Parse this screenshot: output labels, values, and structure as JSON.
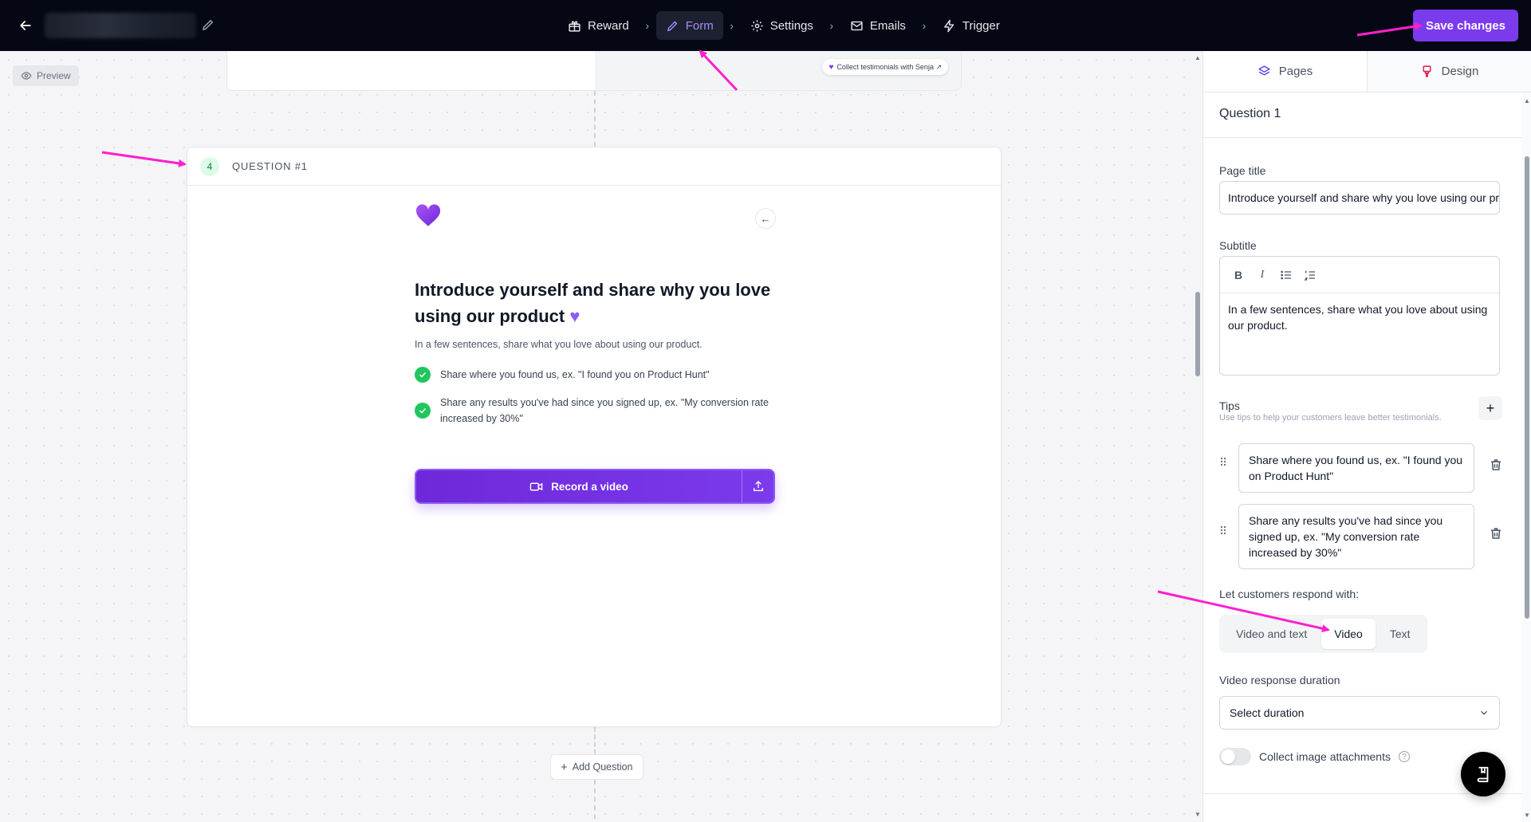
{
  "topbar": {
    "steps": [
      {
        "label": "Reward",
        "icon": "gift-icon"
      },
      {
        "label": "Form",
        "icon": "pencil-icon",
        "active": true
      },
      {
        "label": "Settings",
        "icon": "gear-icon"
      },
      {
        "label": "Emails",
        "icon": "mail-icon"
      },
      {
        "label": "Trigger",
        "icon": "lightning-icon"
      }
    ],
    "save_label": "Save changes"
  },
  "canvas": {
    "preview_label": "Preview",
    "senja_badge": "Collect testimonials with Senja ↗",
    "question": {
      "number": "4",
      "label": "QUESTION #1",
      "title": "Introduce yourself and share why you love using our product",
      "subtitle": "In a few sentences, share what you love about using our product.",
      "tips": [
        "Share where you found us, ex. \"I found you on Product Hunt\"",
        "Share any results you've had since you signed up, ex. \"My conversion rate increased by 30%\""
      ],
      "record_label": "Record a video"
    },
    "add_question_label": "Add Question"
  },
  "panel": {
    "tabs": [
      "Pages",
      "Design"
    ],
    "section_title": "Question 1",
    "page_title_label": "Page title",
    "page_title_value": "Introduce yourself and share why you love using our product",
    "subtitle_label": "Subtitle",
    "subtitle_value": "In a few sentences, share what you love about using our product.",
    "tips_label": "Tips",
    "tips_hint": "Use tips to help your customers leave better testimonials.",
    "tips": [
      "Share where you found us, ex. \"I found you on Product Hunt\"",
      "Share any results you've had since you signed up, ex. \"My conversion rate increased by 30%\""
    ],
    "respond_label": "Let customers respond with:",
    "respond_options": [
      "Video and text",
      "Video",
      "Text"
    ],
    "respond_selected": "Video",
    "duration_label": "Video response duration",
    "duration_value": "Select duration",
    "image_attach_label": "Collect image attachments"
  },
  "colors": {
    "accent": "#7c3aed",
    "topbar": "#050814",
    "annotation": "#ff1fce"
  }
}
